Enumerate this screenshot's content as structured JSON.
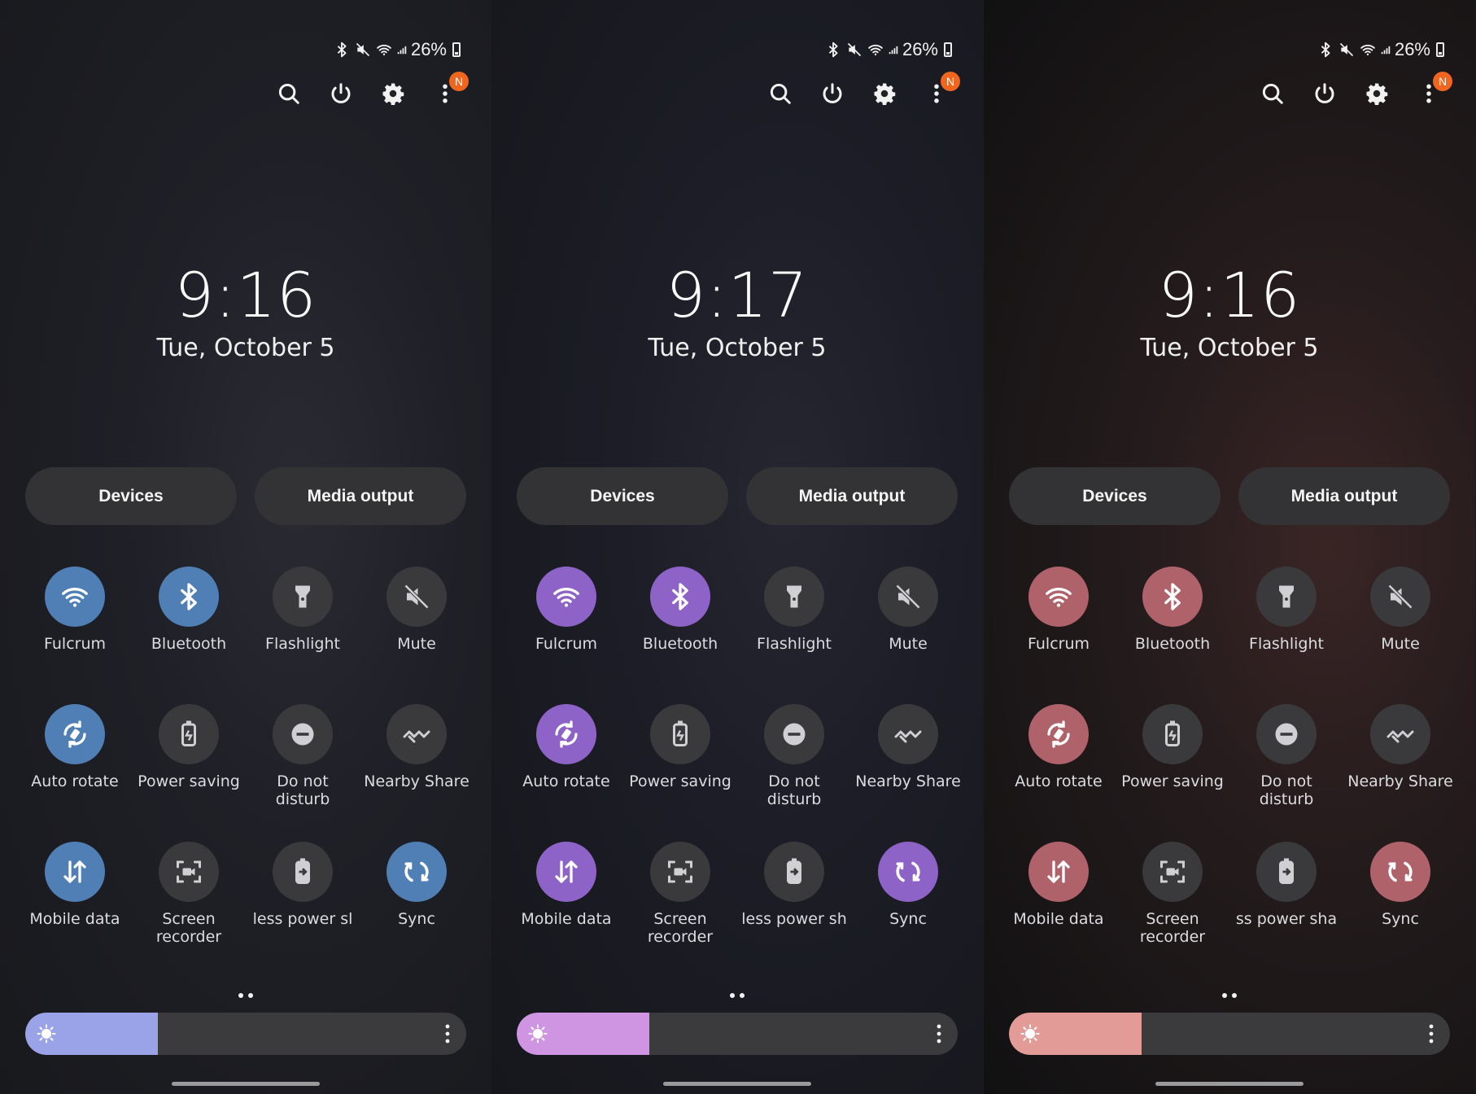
{
  "screens": [
    {
      "status": {
        "battery": "26%"
      },
      "notification_badge": "N",
      "time": "9:16",
      "date": "Tue, October 5",
      "buttons": {
        "devices": "Devices",
        "media_output": "Media output"
      },
      "accent_color": "#4f7fb5",
      "brightness_color": "#9aa3e8",
      "brightness_level": 0.3,
      "tiles": [
        {
          "label": "Fulcrum",
          "icon": "wifi-icon",
          "active": true
        },
        {
          "label": "Bluetooth",
          "icon": "bluetooth-icon",
          "active": true
        },
        {
          "label": "Flashlight",
          "icon": "flashlight-icon",
          "active": false
        },
        {
          "label": "Mute",
          "icon": "mute-icon",
          "active": false
        },
        {
          "label": "Auto rotate",
          "icon": "auto-rotate-icon",
          "active": true
        },
        {
          "label": "Power saving",
          "icon": "power-saving-icon",
          "active": false
        },
        {
          "label": "Do not disturb",
          "icon": "do-not-disturb-icon",
          "active": false
        },
        {
          "label": "Nearby Share",
          "icon": "nearby-share-icon",
          "active": false
        },
        {
          "label": "Mobile data",
          "icon": "mobile-data-icon",
          "active": true
        },
        {
          "label": "Screen recorder",
          "icon": "screen-recorder-icon",
          "active": false
        },
        {
          "label": "less power sl",
          "icon": "wireless-power-share-icon",
          "active": false
        },
        {
          "label": "Sync",
          "icon": "sync-icon",
          "active": true
        }
      ]
    },
    {
      "status": {
        "battery": "26%"
      },
      "notification_badge": "N",
      "time": "9:17",
      "date": "Tue, October 5",
      "buttons": {
        "devices": "Devices",
        "media_output": "Media output"
      },
      "accent_color": "#8e63c7",
      "brightness_color": "#cf95e3",
      "brightness_level": 0.3,
      "tiles": [
        {
          "label": "Fulcrum",
          "icon": "wifi-icon",
          "active": true
        },
        {
          "label": "Bluetooth",
          "icon": "bluetooth-icon",
          "active": true
        },
        {
          "label": "Flashlight",
          "icon": "flashlight-icon",
          "active": false
        },
        {
          "label": "Mute",
          "icon": "mute-icon",
          "active": false
        },
        {
          "label": "Auto rotate",
          "icon": "auto-rotate-icon",
          "active": true
        },
        {
          "label": "Power saving",
          "icon": "power-saving-icon",
          "active": false
        },
        {
          "label": "Do not disturb",
          "icon": "do-not-disturb-icon",
          "active": false
        },
        {
          "label": "Nearby Share",
          "icon": "nearby-share-icon",
          "active": false
        },
        {
          "label": "Mobile data",
          "icon": "mobile-data-icon",
          "active": true
        },
        {
          "label": "Screen recorder",
          "icon": "screen-recorder-icon",
          "active": false
        },
        {
          "label": "less power sh",
          "icon": "wireless-power-share-icon",
          "active": false
        },
        {
          "label": "Sync",
          "icon": "sync-icon",
          "active": true
        }
      ]
    },
    {
      "status": {
        "battery": "26%"
      },
      "notification_badge": "N",
      "time": "9:16",
      "date": "Tue, October 5",
      "buttons": {
        "devices": "Devices",
        "media_output": "Media output"
      },
      "accent_color": "#b0626b",
      "brightness_color": "#e39b97",
      "brightness_level": 0.3,
      "tiles": [
        {
          "label": "Fulcrum",
          "icon": "wifi-icon",
          "active": true
        },
        {
          "label": "Bluetooth",
          "icon": "bluetooth-icon",
          "active": true
        },
        {
          "label": "Flashlight",
          "icon": "flashlight-icon",
          "active": false
        },
        {
          "label": "Mute",
          "icon": "mute-icon",
          "active": false
        },
        {
          "label": "Auto rotate",
          "icon": "auto-rotate-icon",
          "active": true
        },
        {
          "label": "Power saving",
          "icon": "power-saving-icon",
          "active": false
        },
        {
          "label": "Do not disturb",
          "icon": "do-not-disturb-icon",
          "active": false
        },
        {
          "label": "Nearby Share",
          "icon": "nearby-share-icon",
          "active": false
        },
        {
          "label": "Mobile data",
          "icon": "mobile-data-icon",
          "active": true
        },
        {
          "label": "Screen recorder",
          "icon": "screen-recorder-icon",
          "active": false
        },
        {
          "label": "ss power sha",
          "icon": "wireless-power-share-icon",
          "active": false
        },
        {
          "label": "Sync",
          "icon": "sync-icon",
          "active": true
        }
      ]
    }
  ]
}
